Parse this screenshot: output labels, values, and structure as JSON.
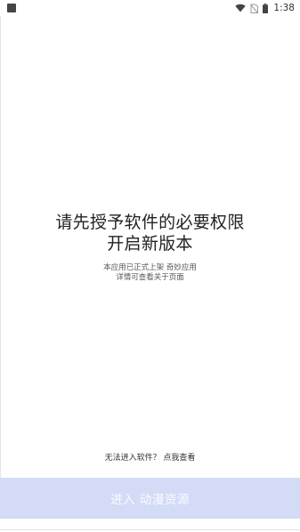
{
  "status_bar": {
    "time": "1:38",
    "icons": [
      "app-notification-icon",
      "wifi-icon",
      "no-sim-icon",
      "battery-icon"
    ]
  },
  "main": {
    "headline": "请先授予软件的必要权限",
    "subline": "开启新版本",
    "description_lines": [
      "本应用已正式上架 奇妙应用",
      "详情可查看关于页面"
    ]
  },
  "help_link": "无法进入软件？ 点我查看",
  "enter_button": {
    "label": "进入 动漫资源",
    "color": "#d4dbf7"
  }
}
